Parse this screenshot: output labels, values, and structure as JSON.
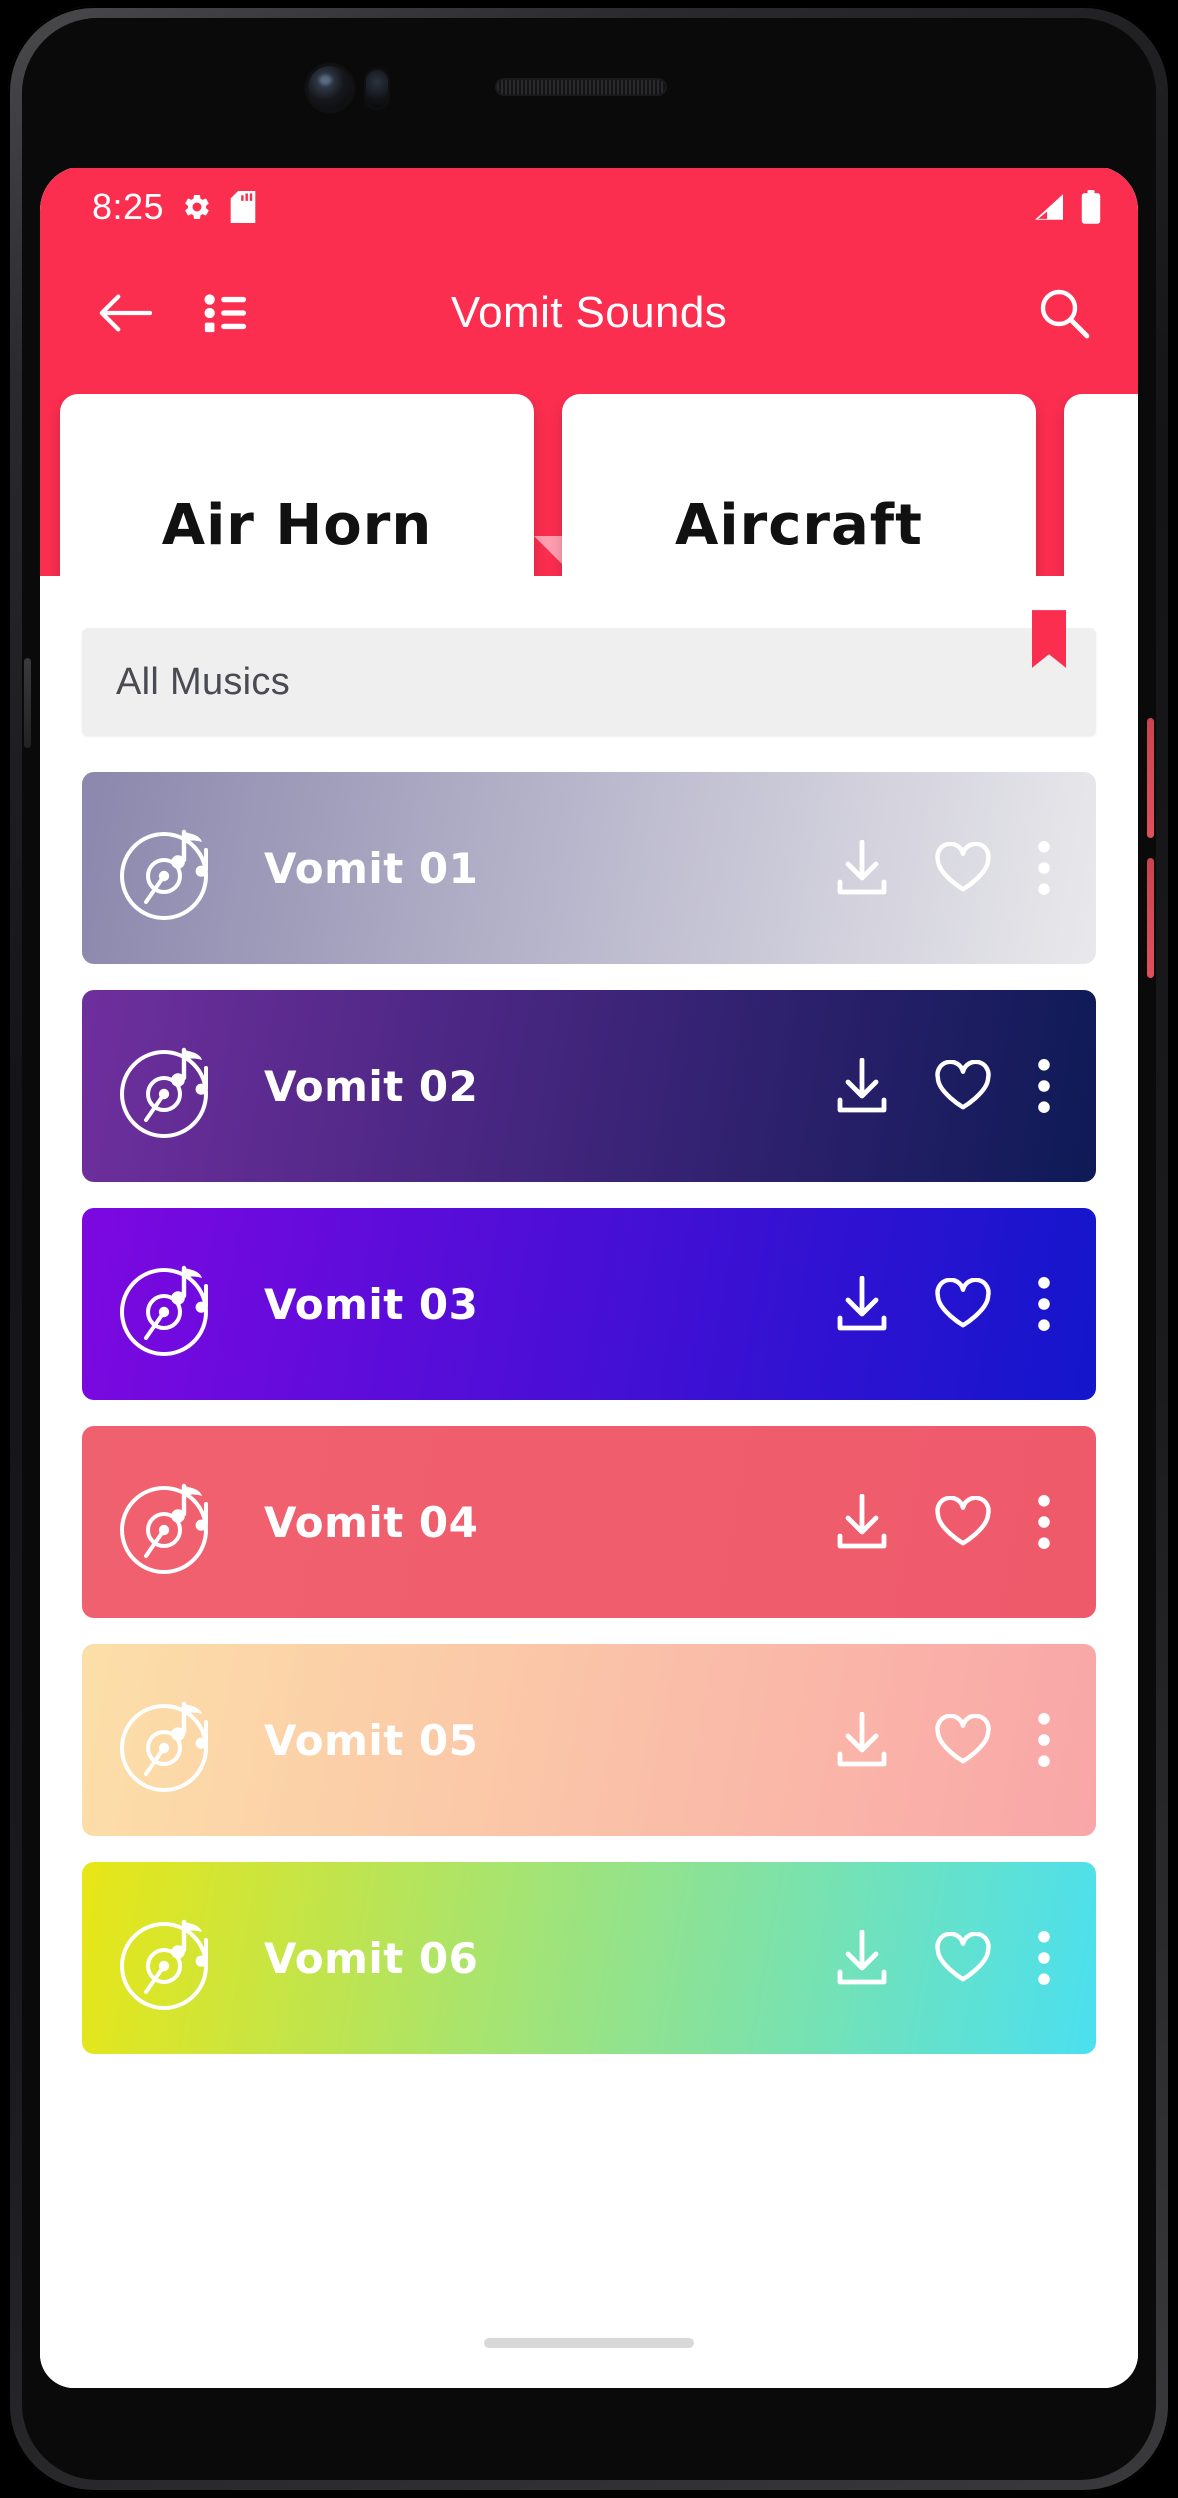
{
  "status_bar": {
    "time": "8:25",
    "left_icons": [
      "gear-icon",
      "sd-card-icon"
    ],
    "right_icons": [
      "signal-icon",
      "battery-icon"
    ]
  },
  "app_bar": {
    "back_icon": "back-arrow-icon",
    "list_icon": "list-icon",
    "title": "Vomit Sounds",
    "search_icon": "search-icon"
  },
  "categories": [
    {
      "label": "Air Horn"
    },
    {
      "label": "Aircraft"
    },
    {
      "label": ""
    }
  ],
  "section": {
    "title": "All Musics",
    "bookmark_icon": "bookmark-icon",
    "bookmark_color": "#FC2E50"
  },
  "colors": {
    "header_red": "#FC2E50",
    "section_bg": "#EFEFEF",
    "section_text": "#4a4a52"
  },
  "row_actions": {
    "download_icon": "download-icon",
    "favorite_icon": "heart-icon",
    "more_icon": "more-vertical-icon"
  },
  "music_items": [
    {
      "name": "Vomit 01",
      "icon": "music-disc-icon",
      "gradient_from": "#8b87ad",
      "gradient_to": "#e9e9ec"
    },
    {
      "name": "Vomit 02",
      "icon": "music-disc-icon",
      "gradient_from": "#6f2f9e",
      "gradient_to": "#0e1a56"
    },
    {
      "name": "Vomit 03",
      "icon": "music-disc-icon",
      "gradient_from": "#7d08e0",
      "gradient_to": "#1316cc"
    },
    {
      "name": "Vomit 04",
      "icon": "music-disc-icon",
      "gradient_from": "#f0616f",
      "gradient_to": "#ef5a6b"
    },
    {
      "name": "Vomit 05",
      "icon": "music-disc-icon",
      "gradient_from": "#fcdfa8",
      "gradient_to": "#f9a6a8"
    },
    {
      "name": "Vomit 06",
      "icon": "music-disc-icon",
      "gradient_from": "#e8e616",
      "gradient_to": "#4ae0f0"
    }
  ]
}
